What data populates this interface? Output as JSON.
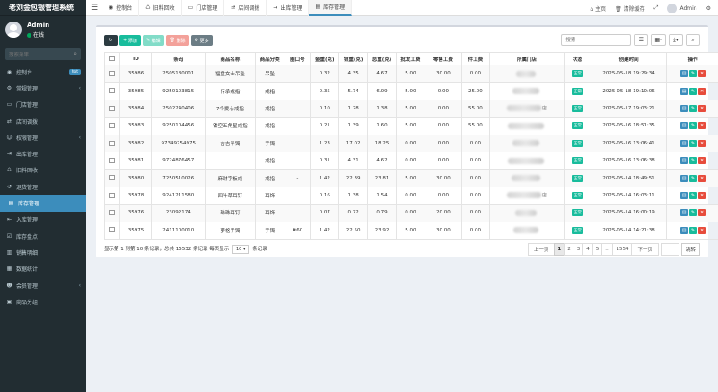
{
  "app": {
    "title": "老刘金包银管理系统"
  },
  "user": {
    "name": "Admin",
    "status": "在线"
  },
  "sidebar": {
    "search_placeholder": "搜索菜单",
    "items": [
      {
        "label": "控制台",
        "icon": "dashboard-icon",
        "badge": "hot",
        "arrow": false,
        "active": false
      },
      {
        "label": "常规管理",
        "icon": "cog-icon",
        "badge": "",
        "arrow": true,
        "active": false
      },
      {
        "label": "门店管理",
        "icon": "store-icon",
        "badge": "",
        "arrow": false,
        "active": false
      },
      {
        "label": "店间调拨",
        "icon": "transfer-icon",
        "badge": "",
        "arrow": false,
        "active": false
      },
      {
        "label": "权限管理",
        "icon": "group-icon",
        "badge": "",
        "arrow": true,
        "active": false
      },
      {
        "label": "出库管理",
        "icon": "export-icon",
        "badge": "",
        "arrow": false,
        "active": false
      },
      {
        "label": "旧料回收",
        "icon": "recycle-icon",
        "badge": "",
        "arrow": false,
        "active": false
      },
      {
        "label": "退货管理",
        "icon": "return-icon",
        "badge": "",
        "arrow": false,
        "active": false
      },
      {
        "label": "库存管理",
        "icon": "inventory-icon",
        "badge": "",
        "arrow": false,
        "active": true
      },
      {
        "label": "入库管理",
        "icon": "import-icon",
        "badge": "",
        "arrow": false,
        "active": false
      },
      {
        "label": "库存盘点",
        "icon": "checklist-icon",
        "badge": "",
        "arrow": false,
        "active": false
      },
      {
        "label": "销售明细",
        "icon": "chart-icon",
        "badge": "",
        "arrow": false,
        "active": false
      },
      {
        "label": "数据统计",
        "icon": "stats-icon",
        "badge": "",
        "arrow": false,
        "active": false
      },
      {
        "label": "会员管理",
        "icon": "member-icon",
        "badge": "",
        "arrow": true,
        "active": false
      },
      {
        "label": "商品分组",
        "icon": "tag-icon",
        "badge": "",
        "arrow": false,
        "active": false
      }
    ]
  },
  "topbar": {
    "tabs": [
      {
        "label": "控制台",
        "icon": "dashboard-icon",
        "active": false
      },
      {
        "label": "旧料回收",
        "icon": "recycle-icon",
        "active": false
      },
      {
        "label": "门店管理",
        "icon": "store-icon",
        "active": false
      },
      {
        "label": "店间调拨",
        "icon": "transfer-icon",
        "active": false
      },
      {
        "label": "出库管理",
        "icon": "export-icon",
        "active": false
      },
      {
        "label": "库存管理",
        "icon": "inventory-icon",
        "active": true
      }
    ],
    "home_label": "主页",
    "clear_cache_label": "清除缓存",
    "user_label": "Admin"
  },
  "toolbar": {
    "add_label": "添加",
    "edit_label": "编辑",
    "delete_label": "删除",
    "more_label": "更多",
    "search_placeholder": "搜索"
  },
  "table": {
    "columns": [
      "ID",
      "条码",
      "商品名称",
      "商品分类",
      "圈口号",
      "金重(克)",
      "银重(克)",
      "总重(克)",
      "批发工费",
      "零售工费",
      "件工费",
      "所属门店",
      "状态",
      "创建时间",
      "操作"
    ],
    "status_label": "正常",
    "rows": [
      [
        "35986",
        "2505180001",
        "福盘女士吊坠",
        "吊坠",
        "",
        "0.32",
        "4.35",
        "4.67",
        "5.00",
        "30.00",
        "0.00",
        "",
        "正常",
        "2025-05-18 19:29:34"
      ],
      [
        "35985",
        "9250103815",
        "传承戒指",
        "戒指",
        "",
        "0.35",
        "5.74",
        "6.09",
        "5.00",
        "0.00",
        "25.00",
        "",
        "正常",
        "2025-05-18 19:10:06"
      ],
      [
        "35984",
        "2502240406",
        "7个爱心戒指",
        "戒指",
        "",
        "0.10",
        "1.28",
        "1.38",
        "5.00",
        "0.00",
        "55.00",
        "",
        "正常",
        "2025-05-17 19:03:21"
      ],
      [
        "35983",
        "9250104456",
        "镂空五角星戒指",
        "戒指",
        "",
        "0.21",
        "1.39",
        "1.60",
        "5.00",
        "0.00",
        "55.00",
        "",
        "正常",
        "2025-05-16 18:51:35"
      ],
      [
        "35982",
        "97349754975",
        "吉吉半镯",
        "手镯",
        "",
        "1.23",
        "17.02",
        "18.25",
        "0.00",
        "0.00",
        "0.00",
        "",
        "正常",
        "2025-05-16 13:06:41"
      ],
      [
        "35981",
        "9724876457",
        "",
        "戒指",
        "",
        "0.31",
        "4.31",
        "4.62",
        "0.00",
        "0.00",
        "0.00",
        "",
        "正常",
        "2025-05-16 13:06:38"
      ],
      [
        "35980",
        "7250510026",
        "麻财字板戒",
        "戒指",
        "-",
        "1.42",
        "22.39",
        "23.81",
        "5.00",
        "30.00",
        "0.00",
        "",
        "正常",
        "2025-05-14 18:49:51"
      ],
      [
        "35978",
        "9241211580",
        "四叶草耳钉",
        "耳饰",
        "",
        "0.16",
        "1.38",
        "1.54",
        "0.00",
        "0.00",
        "0.00",
        "",
        "正常",
        "2025-05-14 16:03:11"
      ],
      [
        "35976",
        "23092174",
        "珠珠耳钉",
        "耳饰",
        "",
        "0.07",
        "0.72",
        "0.79",
        "0.00",
        "20.00",
        "0.00",
        "",
        "正常",
        "2025-05-14 16:00:19"
      ],
      [
        "35975",
        "2411100010",
        "萝格手镯",
        "手镯",
        "#60",
        "1.42",
        "22.50",
        "23.92",
        "5.00",
        "30.00",
        "0.00",
        "",
        "正常",
        "2025-05-14 14:21:38"
      ]
    ],
    "shop_suffixes": [
      "",
      "",
      "店",
      "",
      "",
      "",
      "",
      "店",
      "",
      ""
    ]
  },
  "pagination": {
    "summary_prefix": "显示第 1 到第 10 条记录，总共 15532 条记录 每页显示",
    "page_size": "10",
    "summary_suffix": "条记录",
    "prev_label": "上一页",
    "pages": [
      "1",
      "2",
      "3",
      "4",
      "5",
      "...",
      "1554"
    ],
    "active_page": "1",
    "next_label": "下一页",
    "jump_label": "跳转"
  }
}
